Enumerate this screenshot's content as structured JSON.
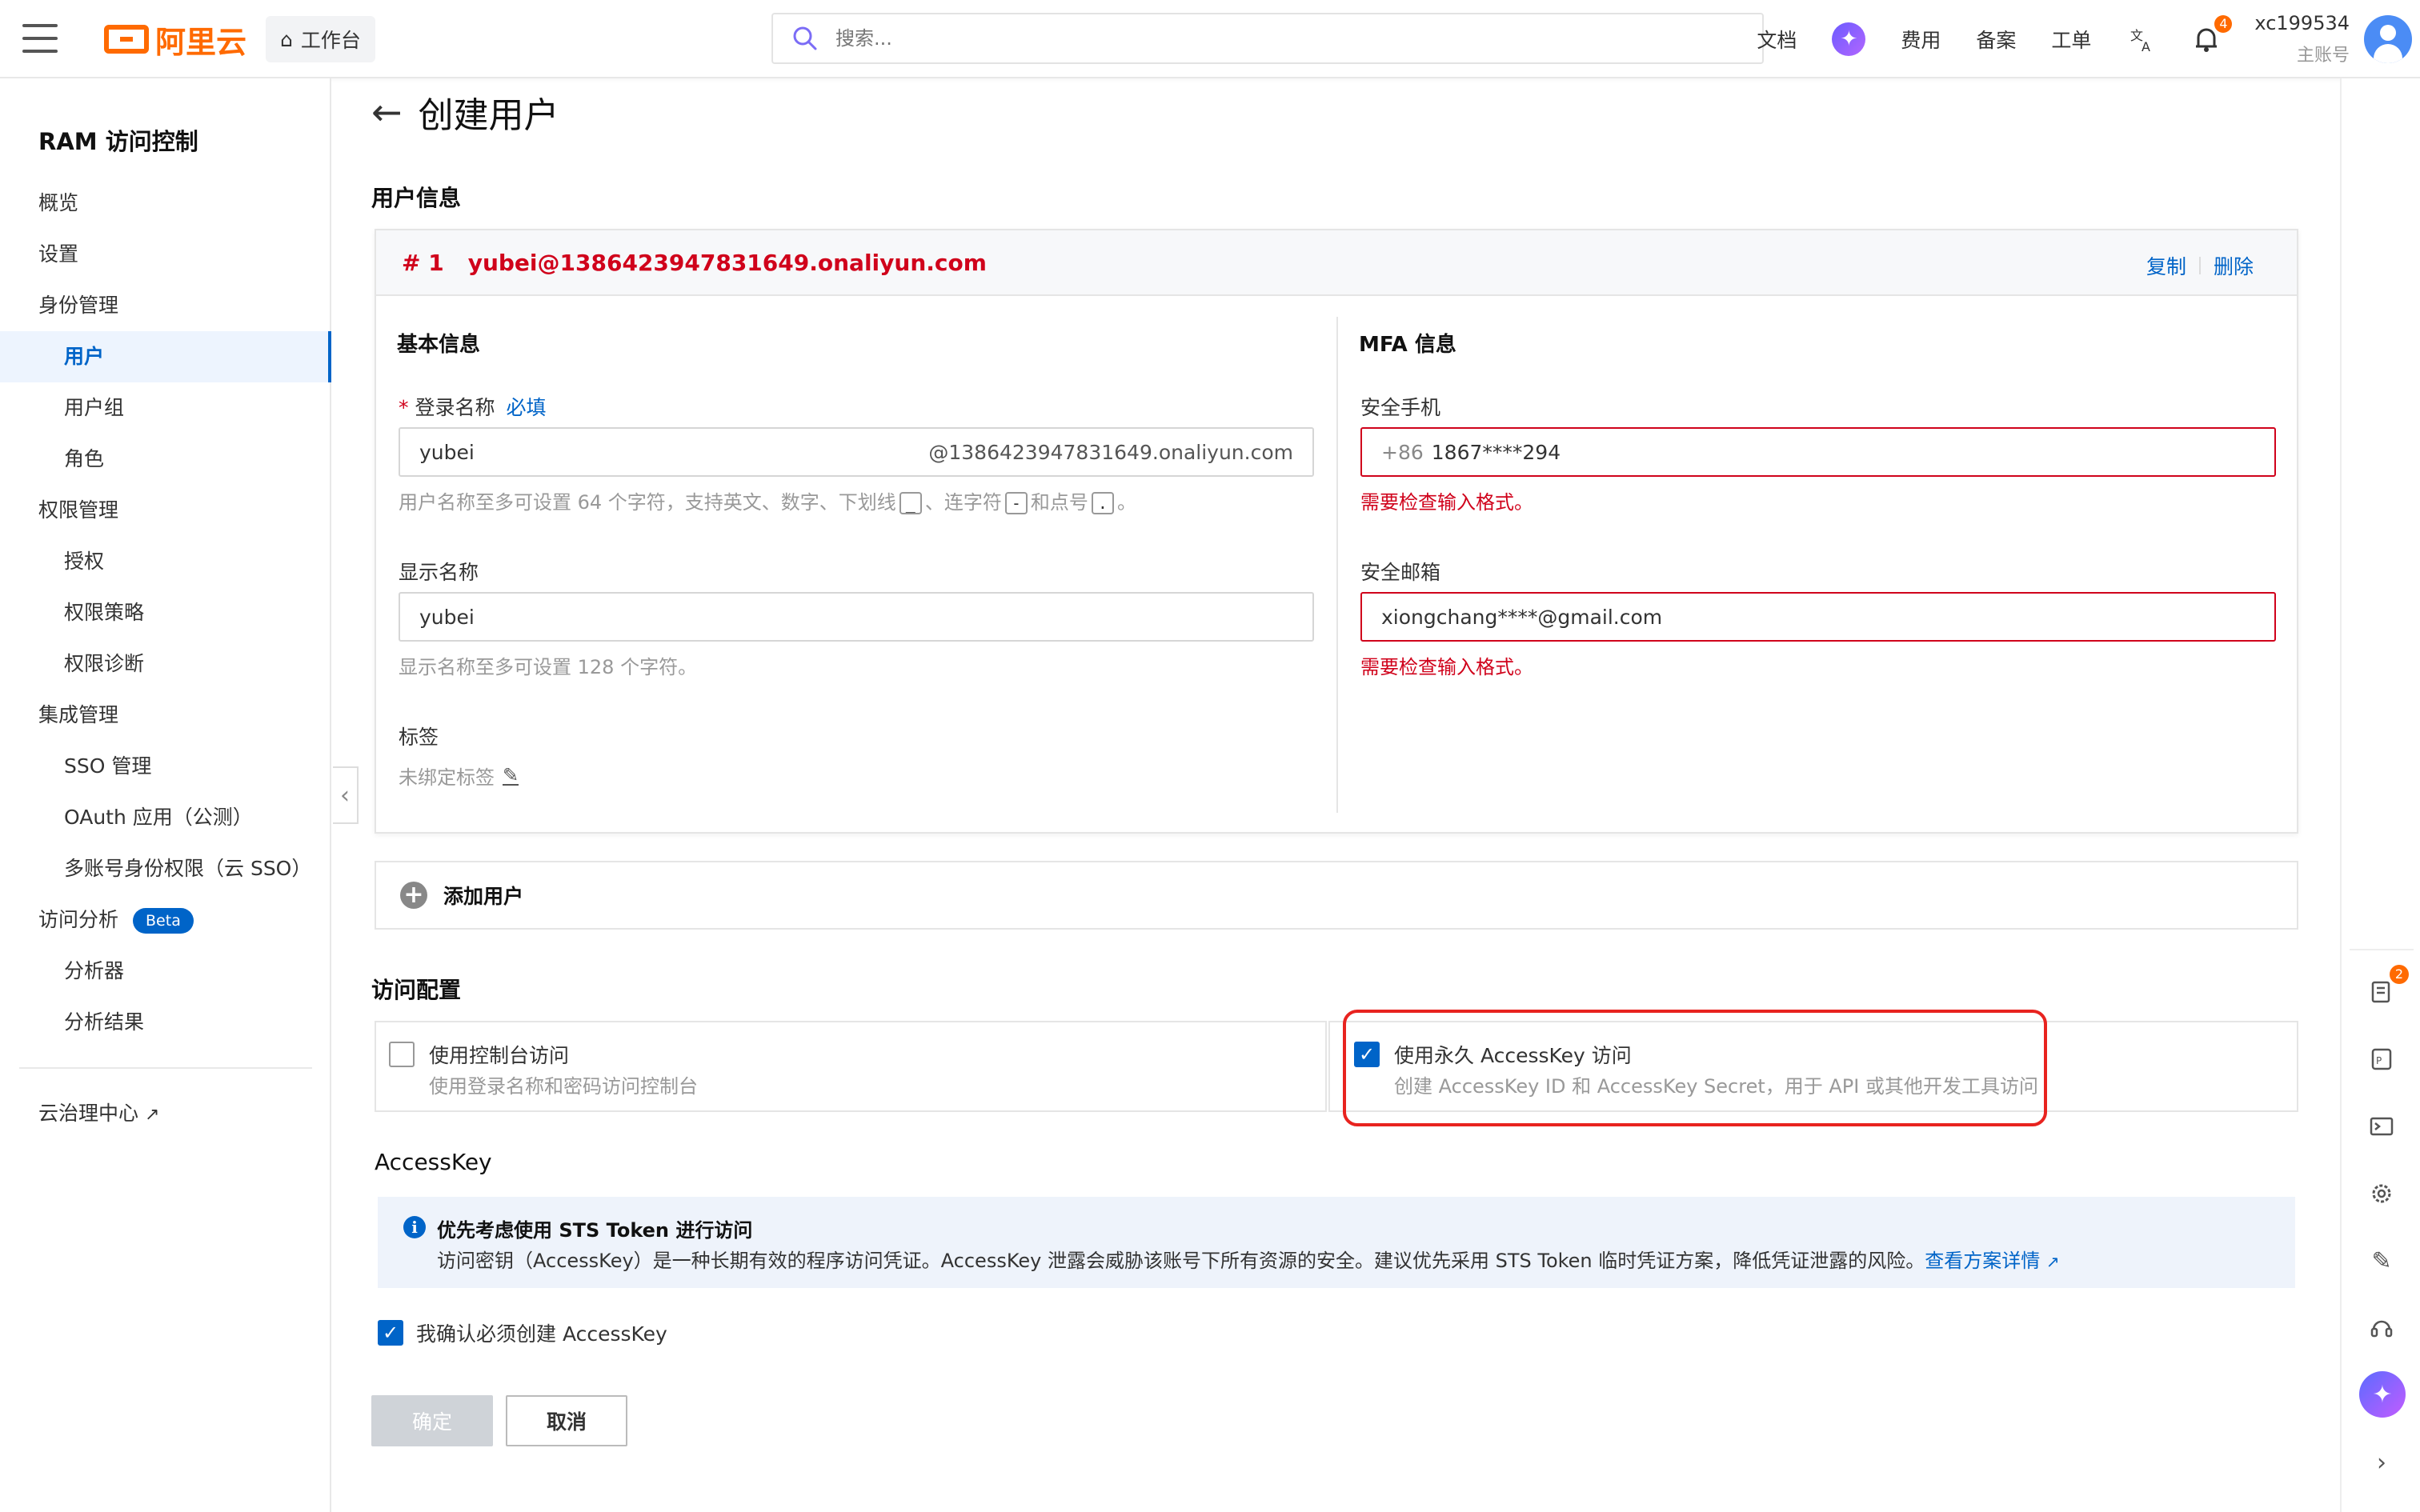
{
  "topbar": {
    "brand": "阿里云",
    "workbench": "工作台",
    "search_placeholder": "搜索...",
    "links": [
      "文档",
      "费用",
      "备案",
      "工单"
    ],
    "notification_count": "4",
    "username": "xc199534",
    "account_type": "主账号"
  },
  "sidebar": {
    "title": "RAM 访问控制",
    "items": [
      {
        "label": "概览",
        "level": 1
      },
      {
        "label": "设置",
        "level": 1
      },
      {
        "label": "身份管理",
        "level": 1
      },
      {
        "label": "用户",
        "level": 2,
        "active": true
      },
      {
        "label": "用户组",
        "level": 2
      },
      {
        "label": "角色",
        "level": 2
      },
      {
        "label": "权限管理",
        "level": 1
      },
      {
        "label": "授权",
        "level": 2
      },
      {
        "label": "权限策略",
        "level": 2
      },
      {
        "label": "权限诊断",
        "level": 2
      },
      {
        "label": "集成管理",
        "level": 1
      },
      {
        "label": "SSO 管理",
        "level": 2
      },
      {
        "label": "OAuth 应用（公测）",
        "level": 2
      },
      {
        "label": "多账号身份权限（云 SSO）",
        "level": 2
      },
      {
        "label": "访问分析",
        "level": 1,
        "badge": "Beta"
      },
      {
        "label": "分析器",
        "level": 2
      },
      {
        "label": "分析结果",
        "level": 2
      }
    ],
    "footer_link": "云治理中心"
  },
  "page": {
    "title": "创建用户",
    "user_info_title": "用户信息",
    "user_card": {
      "index": "# 1",
      "email": "yubei@1386423947831649.onaliyun.com",
      "copy": "复制",
      "delete": "删除",
      "basic_title": "基本信息",
      "login_label": "登录名称",
      "required_link": "必填",
      "login_value": "yubei",
      "login_suffix": "@1386423947831649.onaliyun.com",
      "login_hint_prefix": "用户名称至多可设置 64 个字符，支持英文、数字、下划线",
      "login_hint_mid1": "、连字符",
      "login_hint_mid2": "和点号",
      "login_hint_end": "。",
      "kbd_underscore": "_",
      "kbd_dash": "-",
      "kbd_dot": ".",
      "display_label": "显示名称",
      "display_value": "yubei",
      "display_hint": "显示名称至多可设置 128 个字符。",
      "tag_label": "标签",
      "tag_value": "未绑定标签",
      "mfa_title": "MFA 信息",
      "phone_label": "安全手机",
      "phone_prefix": "+86",
      "phone_value": "1867****294",
      "phone_error": "需要检查输入格式。",
      "email_label": "安全邮箱",
      "email_value": "xiongchang****@gmail.com",
      "email_error": "需要检查输入格式。"
    },
    "add_user": "添加用户",
    "access_title": "访问配置",
    "console_access": {
      "title": "使用控制台访问",
      "desc": "使用登录名称和密码访问控制台",
      "checked": false
    },
    "accesskey_access": {
      "title": "使用永久 AccessKey 访问",
      "desc": "创建 AccessKey ID 和 AccessKey Secret，用于 API 或其他开发工具访问",
      "checked": true
    },
    "accesskey_title": "AccessKey",
    "notice": {
      "title": "优先考虑使用 STS Token 进行访问",
      "body": "访问密钥（AccessKey）是一种长期有效的程序访问凭证。AccessKey 泄露会威胁该账号下所有资源的安全。建议优先采用 STS Token 临时凭证方案，降低凭证泄露的风险。",
      "link": "查看方案详情"
    },
    "confirm_text": "我确认必须创建 AccessKey",
    "ok_button": "确定",
    "cancel_button": "取消"
  },
  "rail": {
    "badge_count": "2"
  }
}
